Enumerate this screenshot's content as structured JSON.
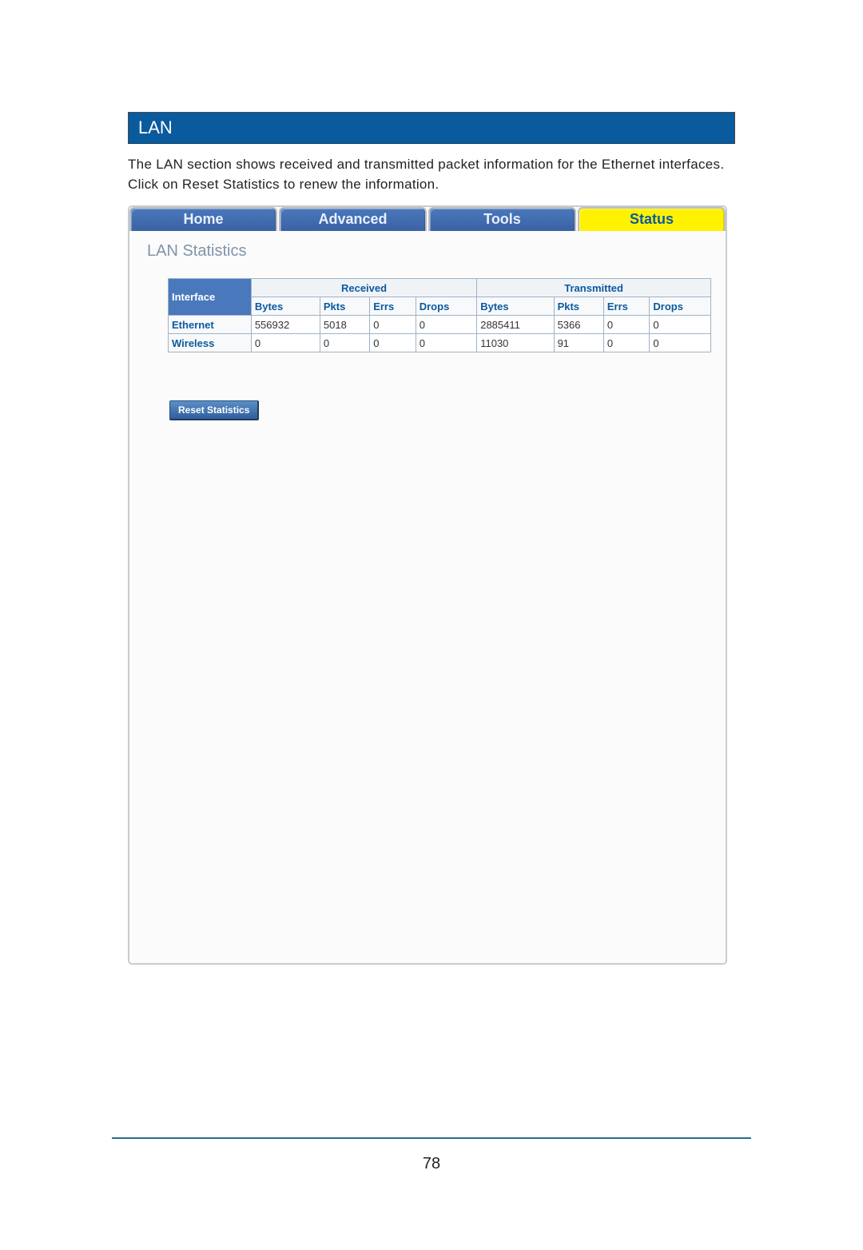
{
  "header": {
    "title": "LAN"
  },
  "description": "The LAN section shows received and transmitted packet information for the Ethernet interfaces.  Click on Reset Statistics to renew the information.",
  "tabs": [
    {
      "label": "Home",
      "active": false
    },
    {
      "label": "Advanced",
      "active": false
    },
    {
      "label": "Tools",
      "active": false
    },
    {
      "label": "Status",
      "active": true
    }
  ],
  "panel": {
    "title": "LAN Statistics",
    "table": {
      "interface_header": "Interface",
      "groups": [
        "Received",
        "Transmitted"
      ],
      "columns": [
        "Bytes",
        "Pkts",
        "Errs",
        "Drops"
      ],
      "rows": [
        {
          "iface": "Ethernet",
          "received": [
            "556932",
            "5018",
            "0",
            "0"
          ],
          "transmitted": [
            "2885411",
            "5366",
            "0",
            "0"
          ]
        },
        {
          "iface": "Wireless",
          "received": [
            "0",
            "0",
            "0",
            "0"
          ],
          "transmitted": [
            "11030",
            "91",
            "0",
            "0"
          ]
        }
      ]
    },
    "reset_button": "Reset Statistics"
  },
  "page_number": "78"
}
